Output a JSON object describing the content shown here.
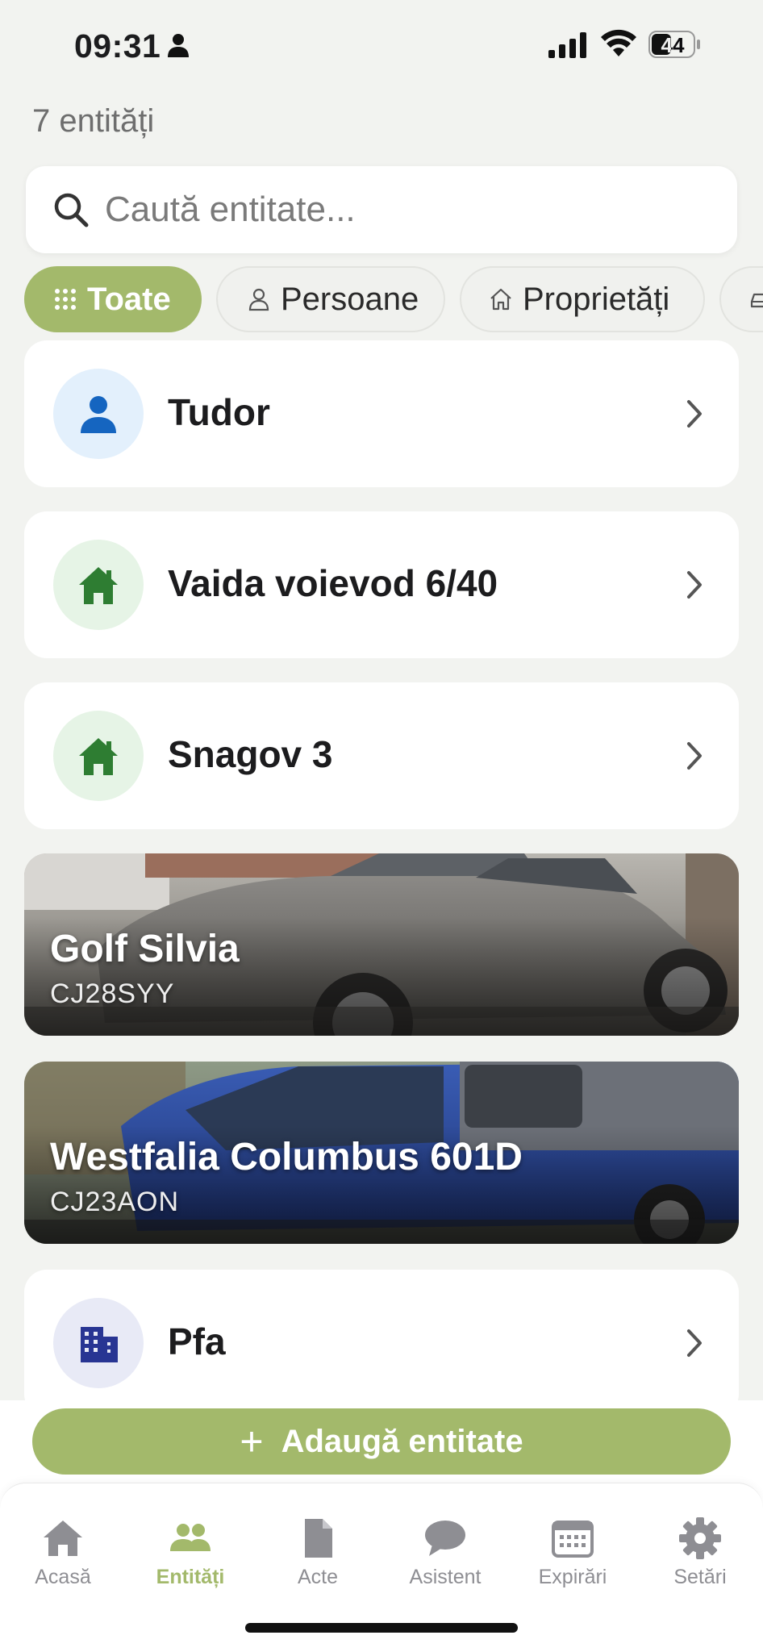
{
  "status_bar": {
    "time": "09:31",
    "battery": "44"
  },
  "count_label": "7 entități",
  "search": {
    "placeholder": "Caută entitate..."
  },
  "filters": [
    {
      "label": "Toate",
      "icon": "grid-icon",
      "active": true
    },
    {
      "label": "Persoane",
      "icon": "person-outline-icon",
      "active": false
    },
    {
      "label": "Proprietăți",
      "icon": "house-outline-icon",
      "active": false
    },
    {
      "label": "",
      "icon": "car-outline-icon",
      "active": false
    }
  ],
  "entities": [
    {
      "name": "Tudor",
      "type": "person",
      "icon": "person-icon",
      "icon_color": "#1565c0",
      "icon_bg": "#e3f0fc"
    },
    {
      "name": "Vaida voievod 6/40",
      "type": "property",
      "icon": "house-icon",
      "icon_color": "#2e7d32",
      "icon_bg": "#e6f4e6"
    },
    {
      "name": "Snagov 3",
      "type": "property",
      "icon": "house-icon",
      "icon_color": "#2e7d32",
      "icon_bg": "#e6f4e6"
    },
    {
      "name": "Golf Silvia",
      "type": "vehicle",
      "plate": "CJ28SYY"
    },
    {
      "name": "Westfalia Columbus 601D",
      "type": "vehicle",
      "plate": "CJ23AON"
    },
    {
      "name": "Pfa",
      "type": "company",
      "icon": "building-icon",
      "icon_color": "#283593",
      "icon_bg": "#e8eaf6"
    }
  ],
  "add_button": {
    "label": "Adaugă entitate"
  },
  "tabs": [
    {
      "label": "Acasă",
      "icon": "home-icon",
      "active": false
    },
    {
      "label": "Entități",
      "icon": "people-icon",
      "active": true
    },
    {
      "label": "Acte",
      "icon": "document-icon",
      "active": false
    },
    {
      "label": "Asistent",
      "icon": "chat-icon",
      "active": false
    },
    {
      "label": "Expirări",
      "icon": "calendar-icon",
      "active": false
    },
    {
      "label": "Setări",
      "icon": "gear-icon",
      "active": false
    }
  ],
  "colors": {
    "accent": "#a3b96b",
    "background": "#f2f3f0",
    "inactive_tab": "#8e8e93"
  }
}
